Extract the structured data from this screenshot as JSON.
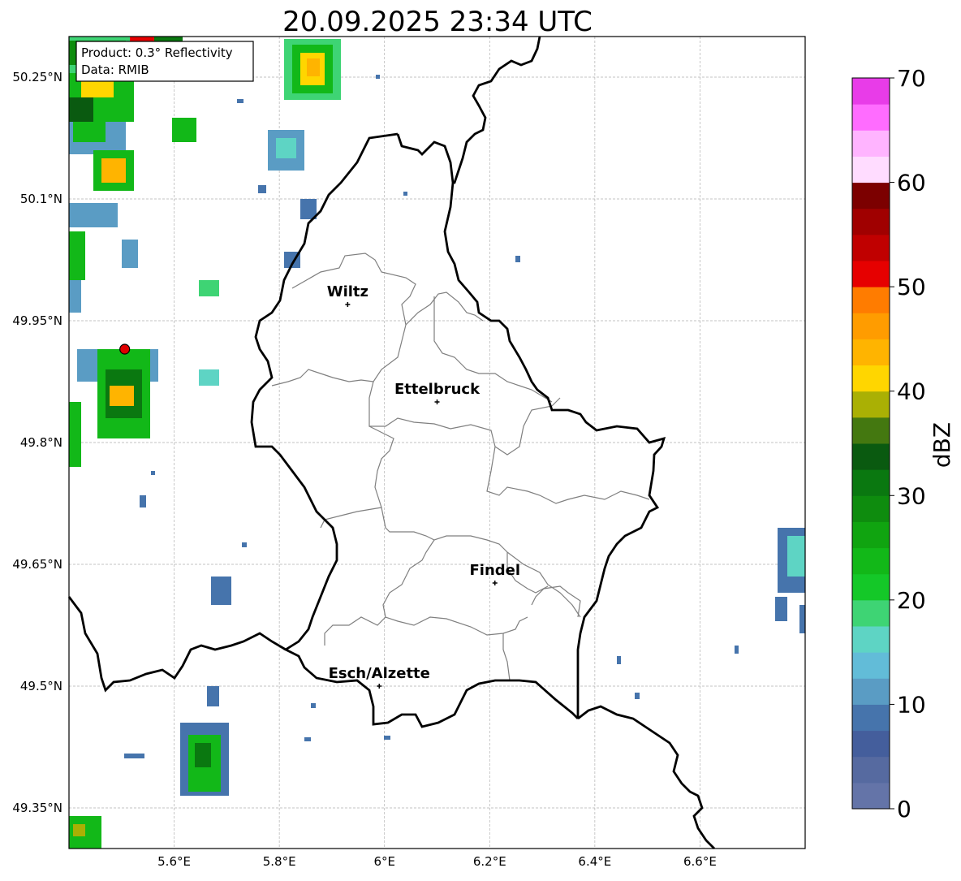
{
  "title": "20.09.2025 23:34 UTC",
  "info": {
    "product": "Product: 0.3° Reflectivity",
    "data": "Data: RMIB"
  },
  "map": {
    "lon_range": [
      5.4,
      6.8
    ],
    "lat_range": [
      49.3,
      50.3
    ],
    "lon_ticks": [
      {
        "value": 5.6,
        "label": "5.6°E"
      },
      {
        "value": 5.8,
        "label": "5.8°E"
      },
      {
        "value": 6.0,
        "label": "6°E"
      },
      {
        "value": 6.2,
        "label": "6.2°E"
      },
      {
        "value": 6.4,
        "label": "6.4°E"
      },
      {
        "value": 6.6,
        "label": "6.6°E"
      }
    ],
    "lat_ticks": [
      {
        "value": 50.25,
        "label": "50.25°N"
      },
      {
        "value": 50.1,
        "label": "50.1°N"
      },
      {
        "value": 49.95,
        "label": "49.95°N"
      },
      {
        "value": 49.8,
        "label": "49.8°N"
      },
      {
        "value": 49.65,
        "label": "49.65°N"
      },
      {
        "value": 49.5,
        "label": "49.5°N"
      },
      {
        "value": 49.35,
        "label": "49.35°N"
      }
    ],
    "grid": true,
    "cities": [
      {
        "name": "Wiltz",
        "lon": 5.93,
        "lat": 49.97
      },
      {
        "name": "Ettelbruck",
        "lon": 6.1,
        "lat": 49.85
      },
      {
        "name": "Findel",
        "lon": 6.21,
        "lat": 49.627
      },
      {
        "name": "Esch/Alzette",
        "lon": 5.99,
        "lat": 49.5
      }
    ],
    "radar_site": {
      "lon": 5.506,
      "lat": 49.915,
      "color": "#e00000"
    },
    "border_color": "#000000",
    "canton_color": "#7f7f7f"
  },
  "colorbar": {
    "label": "dBZ",
    "min": 0,
    "max": 70,
    "ticks": [
      0,
      10,
      20,
      30,
      40,
      50,
      60,
      70
    ],
    "colors": [
      "#6474a8",
      "#566aa0",
      "#445e9c",
      "#4674ac",
      "#5a9cc4",
      "#62bcd8",
      "#5ed4c4",
      "#3ed474",
      "#14c828",
      "#12b818",
      "#10a410",
      "#0e8c0e",
      "#0a7810",
      "#0a5a10",
      "#447810",
      "#aab004",
      "#ffd600",
      "#ffb400",
      "#ff9c00",
      "#ff7c00",
      "#e60000",
      "#c00000",
      "#a00000",
      "#7c0000",
      "#ffdcff",
      "#ffb4ff",
      "#ff6cff",
      "#e83ce8"
    ]
  }
}
